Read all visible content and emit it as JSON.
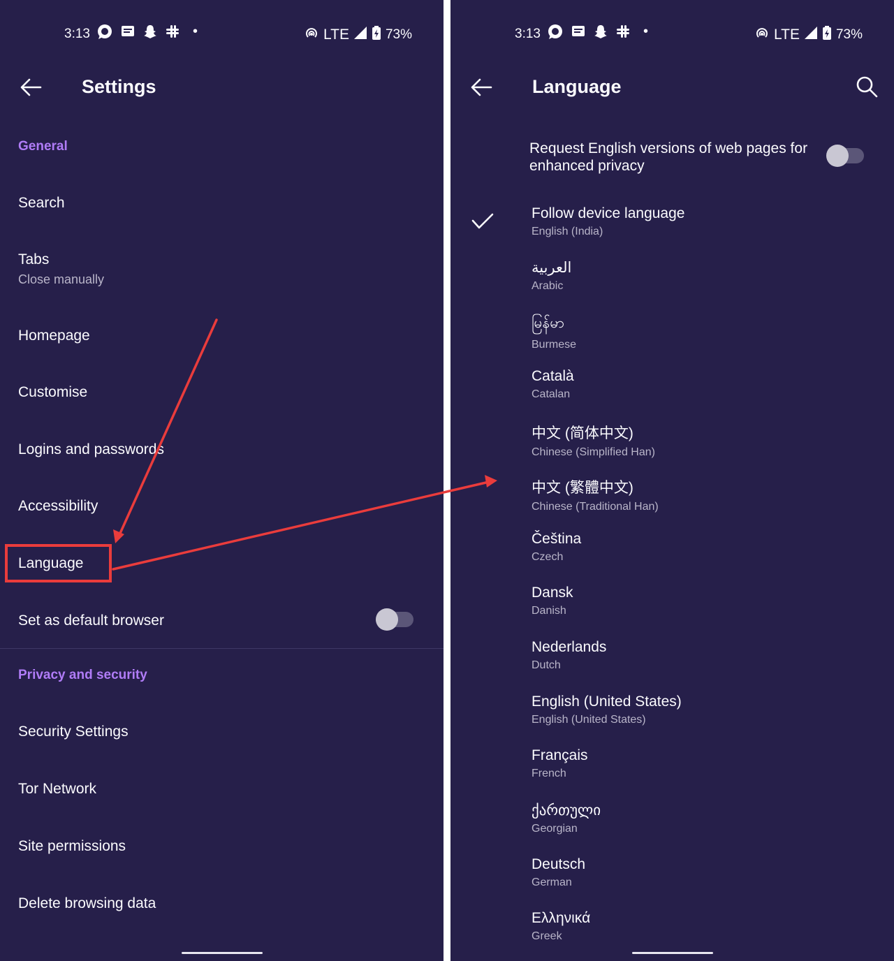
{
  "status_bar": {
    "time": "3:13",
    "network": "LTE",
    "battery": "73%"
  },
  "settings": {
    "title": "Settings",
    "general_header": "General",
    "items": [
      {
        "label": "Search"
      },
      {
        "label": "Tabs",
        "sub": "Close manually"
      },
      {
        "label": "Homepage"
      },
      {
        "label": "Customise"
      },
      {
        "label": "Logins and passwords"
      },
      {
        "label": "Accessibility"
      },
      {
        "label": "Language"
      },
      {
        "label": "Set as default browser"
      }
    ],
    "privacy_header": "Privacy and security",
    "privacy_items": [
      {
        "label": "Security Settings"
      },
      {
        "label": "Tor Network"
      },
      {
        "label": "Site permissions"
      },
      {
        "label": "Delete browsing data"
      }
    ],
    "default_browser_toggle": false
  },
  "language": {
    "title": "Language",
    "request_english_label": "Request English versions of web pages for enhanced privacy",
    "request_english_toggle": false,
    "options": [
      {
        "name": "Follow device language",
        "english": "English (India)",
        "selected": true
      },
      {
        "name": "العربية",
        "english": "Arabic"
      },
      {
        "name": "မြန်မာ",
        "english": "Burmese"
      },
      {
        "name": "Català",
        "english": "Catalan"
      },
      {
        "name": "中文 (简体中文)",
        "english": "Chinese (Simplified Han)"
      },
      {
        "name": "中文 (繁體中文)",
        "english": "Chinese (Traditional Han)"
      },
      {
        "name": "Čeština",
        "english": "Czech"
      },
      {
        "name": "Dansk",
        "english": "Danish"
      },
      {
        "name": "Nederlands",
        "english": "Dutch"
      },
      {
        "name": "English (United States)",
        "english": "English (United States)"
      },
      {
        "name": "Français",
        "english": "French"
      },
      {
        "name": "ქართული",
        "english": "Georgian"
      },
      {
        "name": "Deutsch",
        "english": "German"
      },
      {
        "name": "Ελληνικά",
        "english": "Greek"
      }
    ]
  },
  "colors": {
    "background": "#261f4a",
    "accent": "#b07cf7",
    "annotation": "#ea3c3c"
  },
  "icons": [
    "whatsapp-icon",
    "message-icon",
    "snapchat-icon",
    "slack-icon",
    "hotspot-icon",
    "signal-icon",
    "battery-icon",
    "back-arrow-icon",
    "search-icon",
    "checkmark-icon"
  ]
}
